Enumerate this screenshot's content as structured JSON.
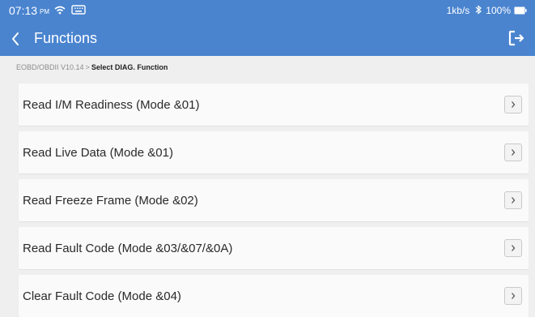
{
  "status_bar": {
    "time": "07:13",
    "ampm": "PM",
    "net_speed": "1kb/s",
    "battery": "100%"
  },
  "title_bar": {
    "title": "Functions"
  },
  "breadcrumb": {
    "path": "EOBD/OBDII V10.14",
    "separator": ">",
    "current": "Select DIAG. Function"
  },
  "menu": {
    "items": [
      {
        "label": "Read I/M Readiness (Mode &01)"
      },
      {
        "label": "Read Live Data (Mode &01)"
      },
      {
        "label": "Read Freeze Frame (Mode &02)"
      },
      {
        "label": "Read Fault Code (Mode &03/&07/&0A)"
      },
      {
        "label": "Clear Fault Code (Mode &04)"
      }
    ]
  },
  "colors": {
    "header_bg": "#4a84cf",
    "page_bg": "#efefef",
    "item_bg": "#fafafa"
  },
  "icons": {
    "wifi": "wifi-icon",
    "keyboard": "keyboard-icon",
    "bluetooth": "bluetooth-icon",
    "battery": "battery-icon",
    "back": "chevron-left-icon",
    "exit": "exit-icon",
    "item_arrow": "chevron-right-icon"
  }
}
